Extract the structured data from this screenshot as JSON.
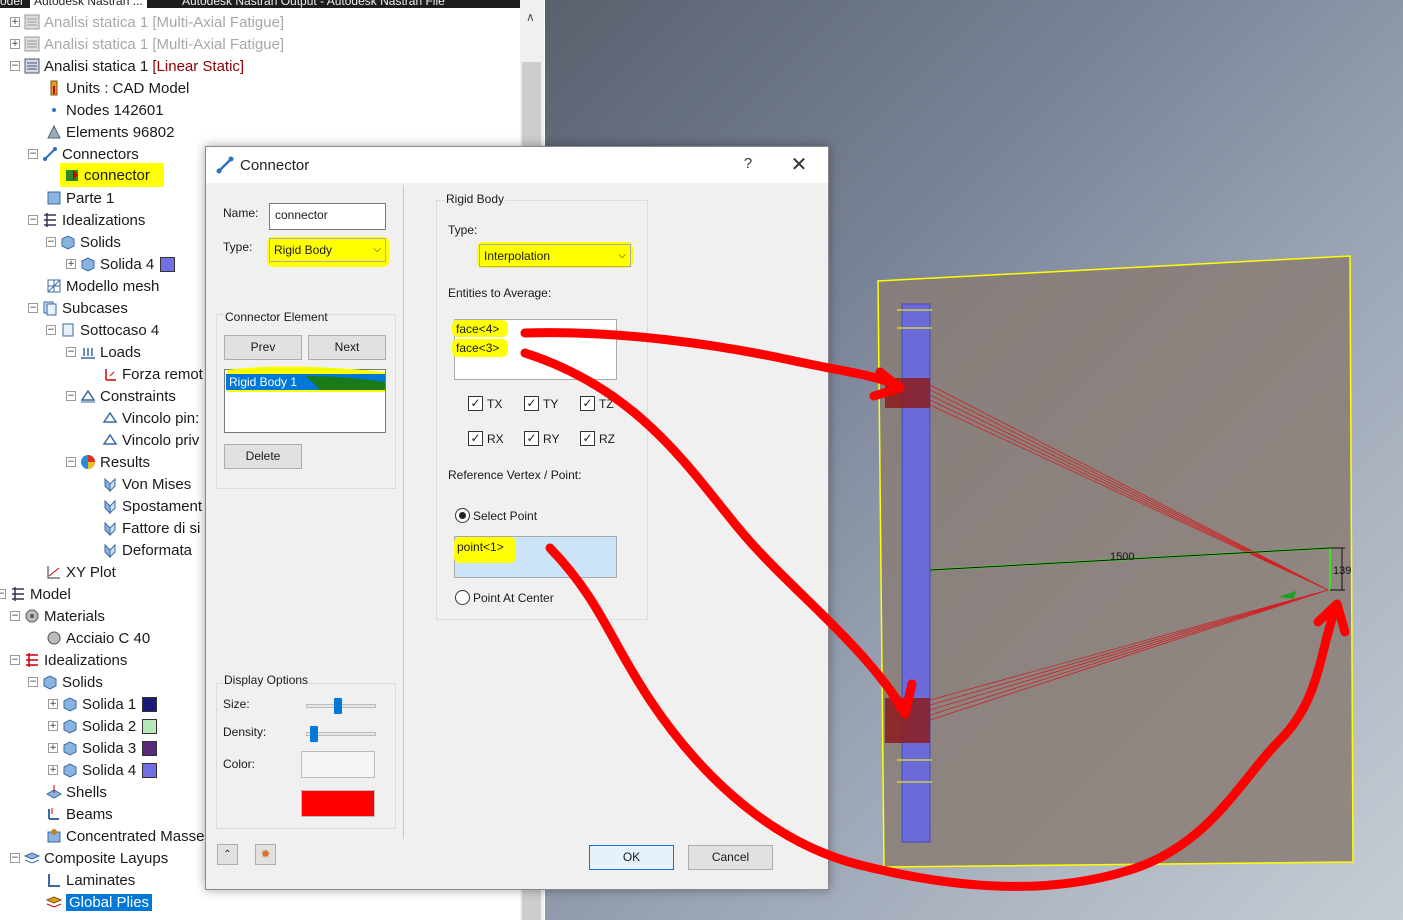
{
  "tabs": [
    "odel",
    "Autodesk Nastran ...",
    "Autodesk Nastran Output - Autodesk Nastran File"
  ],
  "tree": {
    "analysis_a": "Analisi statica 1",
    "analysis_a_type": "[Multi-Axial Fatigue]",
    "analysis_b": "Analisi statica 1",
    "analysis_b_type": "[Multi-Axial Fatigue]",
    "analysis_c": "Analisi statica 1",
    "analysis_c_type": "[Linear Static]",
    "units": "Units : CAD Model",
    "nodes": "Nodes 142601",
    "elements": "Elements 96802",
    "connectors": "Connectors",
    "connector": "connector",
    "parte": "Parte 1",
    "idealizations": "Idealizations",
    "solids": "Solids",
    "solida4": "Solida 4",
    "mesh": "Modello mesh",
    "subcases": "Subcases",
    "sottocaso": "Sottocaso 4",
    "loads": "Loads",
    "forza": "Forza remot",
    "constraints": "Constraints",
    "vincolo1": "Vincolo pin:",
    "vincolo2": "Vincolo priv",
    "results": "Results",
    "vonmises": "Von Mises",
    "spostamento": "Spostament",
    "fattore": "Fattore di si",
    "deformata": "Deformata",
    "xyplot": "XY Plot",
    "model": "Model",
    "materials": "Materials",
    "acciaio": "Acciaio C 40",
    "idealizations2": "Idealizations",
    "solids2": "Solids",
    "s1": "Solida 1",
    "s2": "Solida 2",
    "s3": "Solida 3",
    "s4": "Solida 4",
    "shells": "Shells",
    "beams": "Beams",
    "masses": "Concentrated Masses",
    "composite": "Composite Layups",
    "laminates": "Laminates",
    "globalplies": "Global Plies"
  },
  "colors": {
    "solida1": "#1a1a78",
    "solida2": "#b8e8b8",
    "solida3": "#5a2a7a",
    "solida4": "#7070e0",
    "display_color": "#ff0000",
    "highlight": "#ffff00",
    "annotation": "#ff0000"
  },
  "dialog": {
    "title": "Connector",
    "help": "?",
    "close": "✕",
    "name_label": "Name:",
    "name_value": "connector",
    "type_label": "Type:",
    "type_value": "Rigid Body",
    "ce_group": "Connector Element",
    "prev": "Prev",
    "next": "Next",
    "list_item": "Rigid Body 1",
    "delete": "Delete",
    "display_group": "Display Options",
    "size_label": "Size:",
    "density_label": "Density:",
    "color_label": "Color:",
    "rb_group": "Rigid Body",
    "rb_type_label": "Type:",
    "rb_type_value": "Interpolation",
    "entities_label": "Entities to Average:",
    "face1": "face<4>",
    "face2": "face<3>",
    "tx": "TX",
    "ty": "TY",
    "tz": "TZ",
    "rx": "RX",
    "ry": "RY",
    "rz": "RZ",
    "ref_label": "Reference Vertex / Point:",
    "select_point": "Select Point",
    "point": "point<1>",
    "center": "Point At Center",
    "ok": "OK",
    "cancel": "Cancel"
  },
  "viewport": {
    "dim1": "1500",
    "dim2": "139"
  }
}
